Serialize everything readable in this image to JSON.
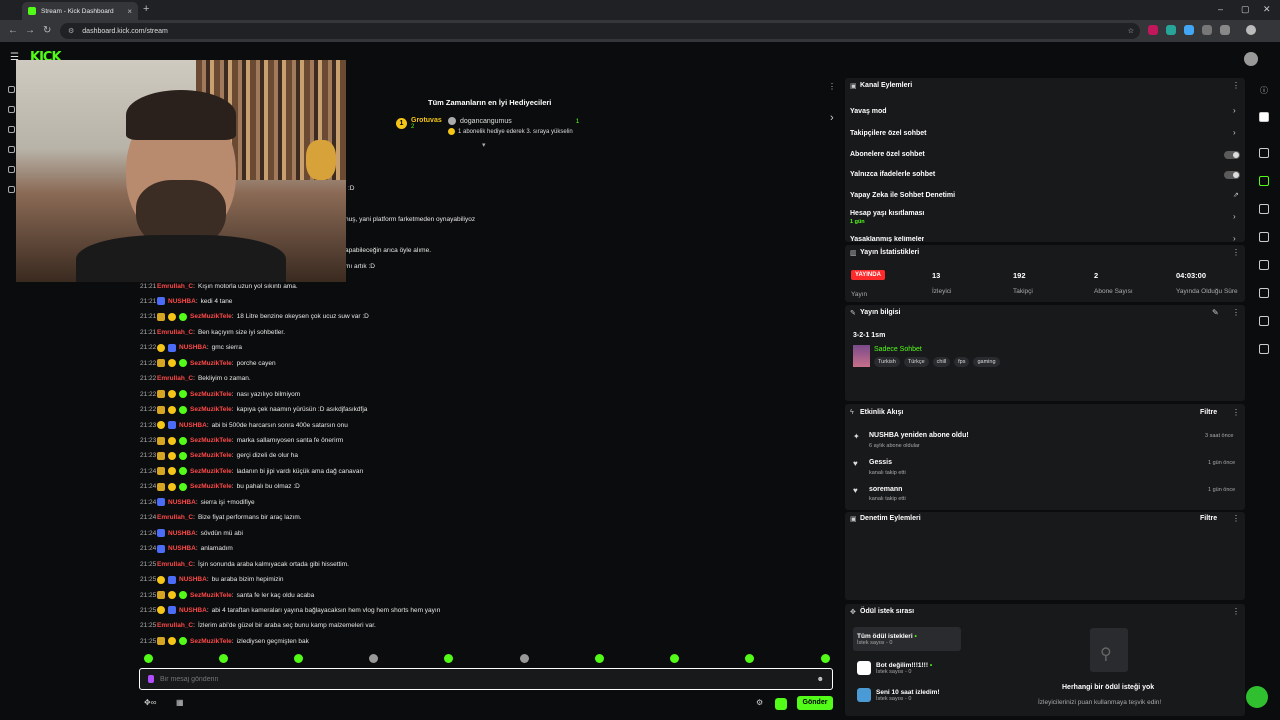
{
  "browser": {
    "tab_title": "Stream - Kick Dashboard",
    "url": "dashboard.kick.com/stream"
  },
  "kick_logo": "KICK",
  "gifters": {
    "title": "Tüm Zamanların en İyi Hediyecileri",
    "first_name": "Grotuvas",
    "first_count": "2",
    "second_name": "dogancangumus",
    "second_count": "1",
    "second_note": "1 abonelik hediye ederek 3. sıraya yükselin"
  },
  "chat_fragments": [
    ":D",
    "nuş, yani platform farketmeden oynayabiliyoz",
    "apabileceğin arıca öyle alıme.",
    "mı artık :D"
  ],
  "chat": [
    {
      "time": "21:21",
      "user": "Emrullah_C",
      "color": "#ff4a4a",
      "msg": "Kışın motorla uzun yol sıkıntı ama.",
      "badges": []
    },
    {
      "time": "21:21",
      "user": "NUSHBA",
      "color": "#ff4a4a",
      "msg": "kedi 4 tane",
      "badges": [
        "gift"
      ]
    },
    {
      "time": "21:21",
      "user": "SezMuzikTele",
      "color": "#ff4a4a",
      "msg": "18 Litre benzine okeysen çok ucuz suw var :D",
      "badges": [
        "crown",
        "sub",
        "vip"
      ]
    },
    {
      "time": "21:21",
      "user": "Emrullah_C",
      "color": "#ff4a4a",
      "msg": "Ben kaçıyım size iyi sohbetler.",
      "badges": []
    },
    {
      "time": "21:22",
      "user": "NUSHBA",
      "color": "#ff4a4a",
      "msg": "gmc sierra",
      "badges": [
        "sub",
        "gift"
      ]
    },
    {
      "time": "21:22",
      "user": "SezMuzikTele",
      "color": "#ff4a4a",
      "msg": "porche cayen",
      "badges": [
        "crown",
        "sub",
        "vip"
      ]
    },
    {
      "time": "21:22",
      "user": "Emrullah_C",
      "color": "#ff4a4a",
      "msg": "Bekliyim o zaman.",
      "badges": []
    },
    {
      "time": "21:22",
      "user": "SezMuzikTele",
      "color": "#ff4a4a",
      "msg": "nası yazılıyo bilmiyom",
      "badges": [
        "crown",
        "sub",
        "vip"
      ]
    },
    {
      "time": "21:22",
      "user": "SezMuzikTele",
      "color": "#ff4a4a",
      "msg": "kapıya çek naamın yürüsün :D asıkdjfasıkdfja",
      "badges": [
        "crown",
        "sub",
        "vip"
      ]
    },
    {
      "time": "21:23",
      "user": "NUSHBA",
      "color": "#ff4a4a",
      "msg": "abi bi 500de harcarsın sonra 400e satarsın onu",
      "badges": [
        "sub",
        "gift"
      ]
    },
    {
      "time": "21:23",
      "user": "SezMuzikTele",
      "color": "#ff4a4a",
      "msg": "marka sallamıyosen santa fe önerirm",
      "badges": [
        "crown",
        "sub",
        "vip"
      ]
    },
    {
      "time": "21:23",
      "user": "SezMuzikTele",
      "color": "#ff4a4a",
      "msg": "gerçi dizeli de olur ha",
      "badges": [
        "crown",
        "sub",
        "vip"
      ]
    },
    {
      "time": "21:24",
      "user": "SezMuzikTele",
      "color": "#ff4a4a",
      "msg": "ladanın bi jipi vardı küçük ama dağ canavarı",
      "badges": [
        "crown",
        "sub",
        "vip"
      ]
    },
    {
      "time": "21:24",
      "user": "SezMuzikTele",
      "color": "#ff4a4a",
      "msg": "bu pahalı bu olmaz :D",
      "badges": [
        "crown",
        "sub",
        "vip"
      ]
    },
    {
      "time": "21:24",
      "user": "NUSHBA",
      "color": "#ff4a4a",
      "msg": "sierra işi +modifiye",
      "badges": [
        "gift"
      ]
    },
    {
      "time": "21:24",
      "user": "Emrullah_C",
      "color": "#ff4a4a",
      "msg": "Bize fiyat performans bir araç lazım.",
      "badges": []
    },
    {
      "time": "21:24",
      "user": "NUSHBA",
      "color": "#ff4a4a",
      "msg": "sövdün mü abi",
      "badges": [
        "gift"
      ]
    },
    {
      "time": "21:24",
      "user": "NUSHBA",
      "color": "#ff4a4a",
      "msg": "anlamadım",
      "badges": [
        "gift"
      ]
    },
    {
      "time": "21:25",
      "user": "Emrullah_C",
      "color": "#ff4a4a",
      "msg": "İşin sonunda araba kalmıyacak ortada gibi hissettim.",
      "badges": []
    },
    {
      "time": "21:25",
      "user": "NUSHBA",
      "color": "#ff4a4a",
      "msg": "bu araba bizim hepimizin",
      "badges": [
        "sub",
        "gift"
      ]
    },
    {
      "time": "21:25",
      "user": "SezMuzikTele",
      "color": "#ff4a4a",
      "msg": "santa fe ler kaç oldu acaba",
      "badges": [
        "crown",
        "sub",
        "vip"
      ]
    },
    {
      "time": "21:25",
      "user": "NUSHBA",
      "color": "#ff4a4a",
      "msg": "abi 4 taraftan kameraları yayına bağlayacaksın hem vlog hem shorts hem yayın",
      "badges": [
        "sub",
        "gift"
      ]
    },
    {
      "time": "21:25",
      "user": "Emrullah_C",
      "color": "#ff4a4a",
      "msg": "İzlerim abi'de güzel bir araba seç bunu kamp malzemeleri var.",
      "badges": []
    },
    {
      "time": "21:25",
      "user": "SezMuzikTele",
      "color": "#ff4a4a",
      "msg": "izlediysen geçmişten bak",
      "badges": [
        "crown",
        "sub",
        "vip"
      ]
    }
  ],
  "input": {
    "placeholder": "Bir mesaj gönderin",
    "send_label": "Gönder"
  },
  "channel_actions": {
    "title": "Kanal Eylemleri",
    "slow_mode": "Yavaş mod",
    "followers_only": "Takipçilere özel sohbet",
    "subs_only": "Abonelere özel sohbet",
    "emotes_only": "Yalnızca ifadelerle sohbet",
    "ai_moderation": "Yapay Zeka ile Sohbet Denetimi",
    "age_limit": "Hesap yaşı kısıtlaması",
    "age_limit_value": "1 gün",
    "banned_words": "Yasaklanmış kelimeler"
  },
  "stream_stats": {
    "title": "Yayın İstatistikleri",
    "live": "YAYINDA",
    "stream_label": "Yayın",
    "viewers": "13",
    "viewers_label": "İzleyici",
    "followers": "192",
    "followers_label": "Takipçi",
    "subs": "2",
    "subs_label": "Abone Sayısı",
    "duration": "04:03:00",
    "duration_label": "Yayında Olduğu Süre"
  },
  "stream_info": {
    "title": "Yayın bilgisi",
    "stream_title": "3-2-1 1sm",
    "category": "Sadece Sohbet",
    "tags": [
      "Turkish",
      "Türkçe",
      "chill",
      "fps",
      "gaming"
    ]
  },
  "activity": {
    "title": "Etkinlik Akışı",
    "filter": "Filtre",
    "items": [
      {
        "title": "NUSHBA yeniden abone oldu!",
        "sub": "6 aylık abone oldular",
        "time": "3 saat önce"
      },
      {
        "title": "Gessis",
        "sub": "kanalı takip etti",
        "time": "1 gün önce"
      },
      {
        "title": "soremann",
        "sub": "kanalı takip etti",
        "time": "1 gün önce"
      }
    ]
  },
  "mod_actions": {
    "title": "Denetim Eylemleri",
    "filter": "Filtre"
  },
  "rewards": {
    "title": "Ödül istek sırası",
    "items": [
      {
        "title": "Tüm ödül istekleri",
        "sub": "İstek sayısı - 0"
      },
      {
        "title": "Bot değilim!!!1!!!",
        "sub": "İstek sayısı - 0"
      },
      {
        "title": "Seni 10 saat izledim!",
        "sub": "İstek sayısı - 0"
      }
    ],
    "empty_title": "Herhangi bir ödül isteği yok",
    "empty_sub": "İzleyicilerinizi puan kullanmaya teşvik edin!"
  }
}
